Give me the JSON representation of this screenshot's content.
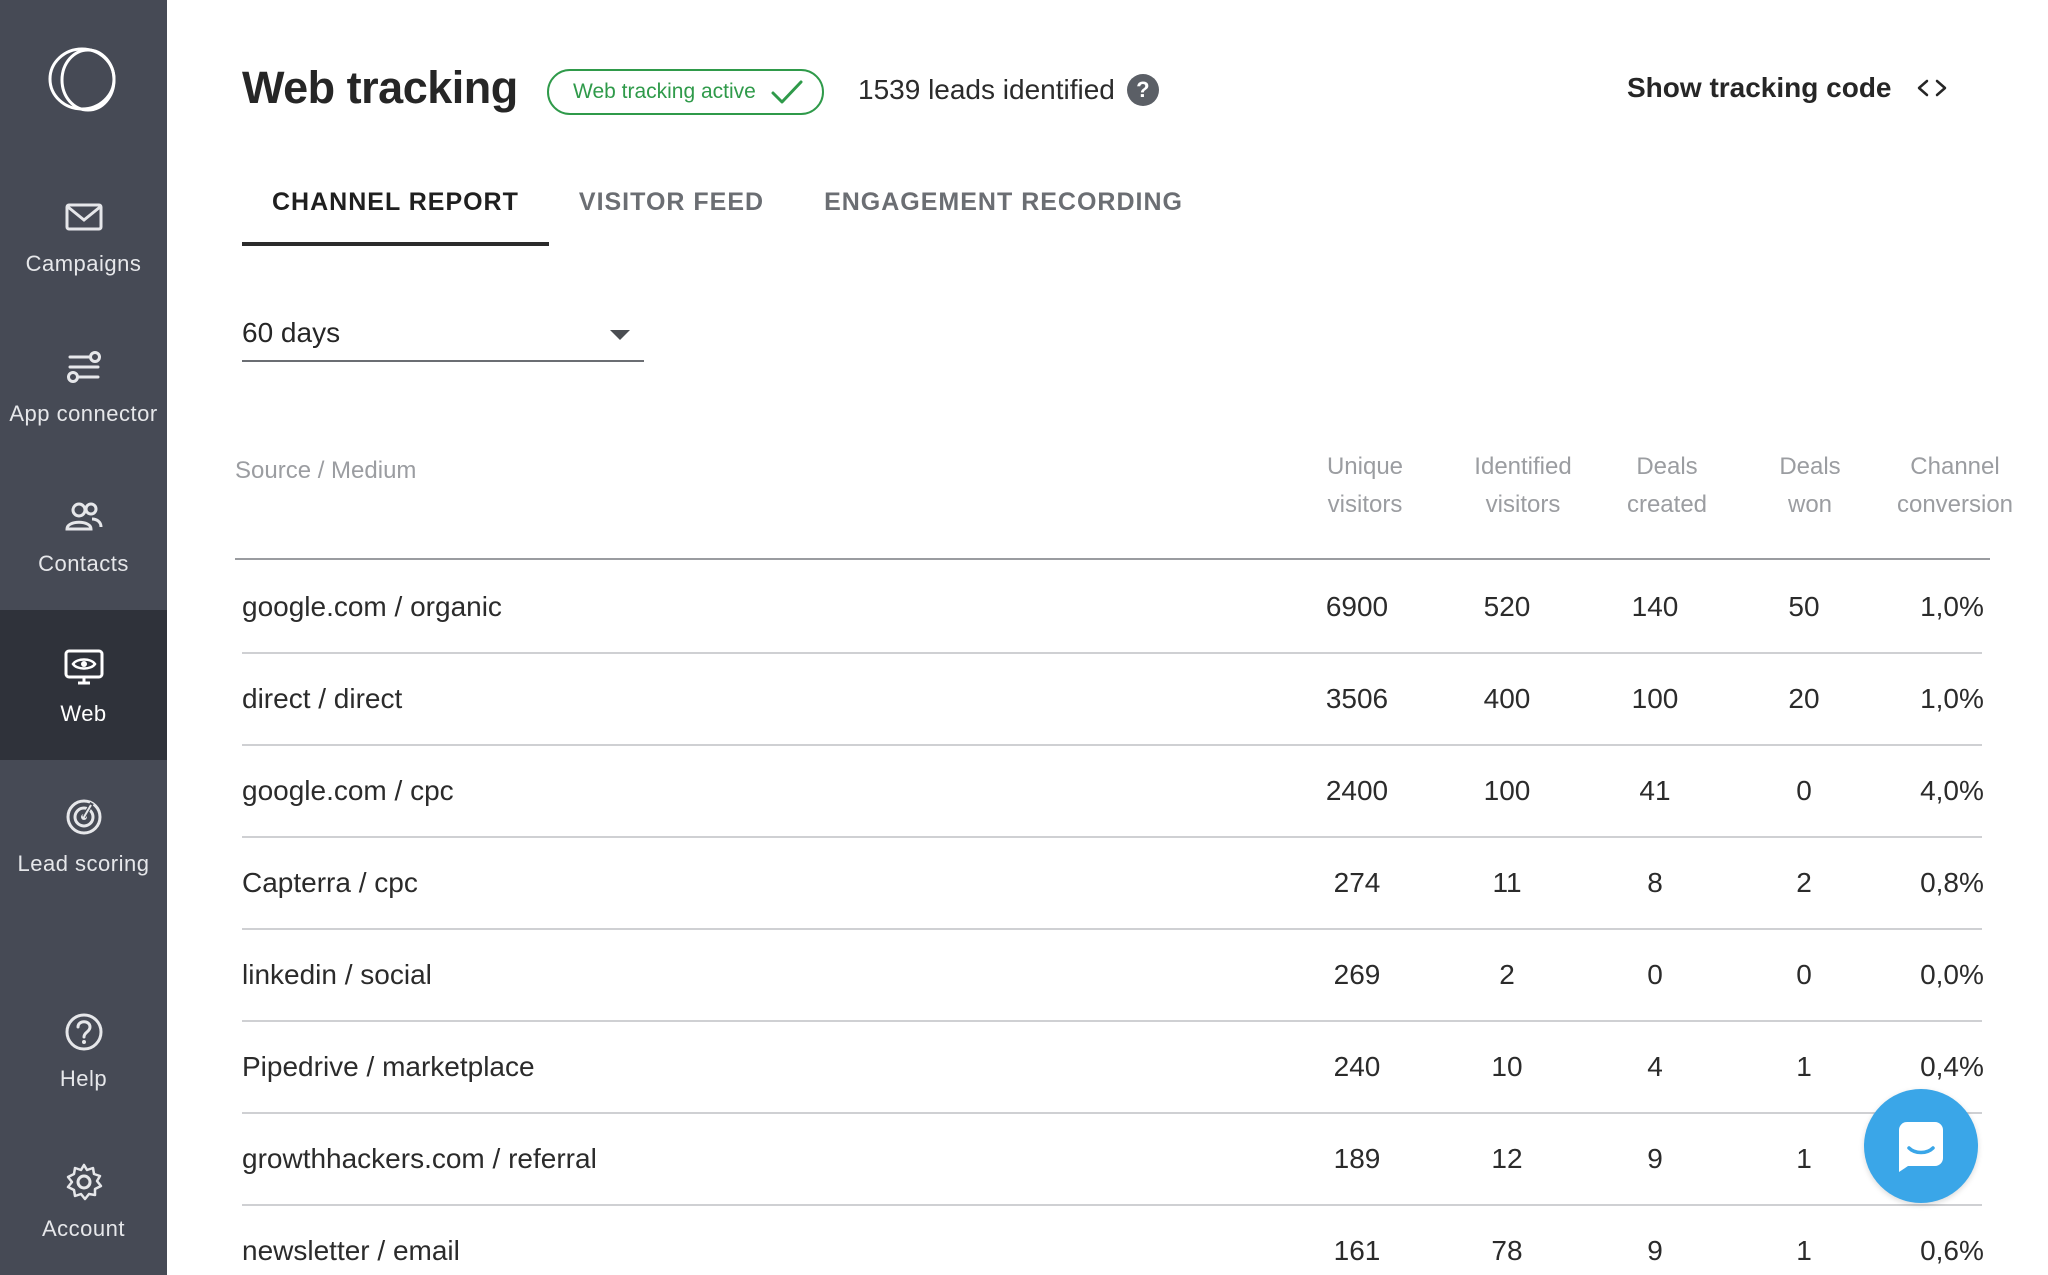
{
  "sidebar": {
    "items": [
      {
        "name": "campaigns",
        "label": "Campaigns",
        "icon": "mail-icon"
      },
      {
        "name": "app-connector",
        "label": "App connector",
        "icon": "connector-icon"
      },
      {
        "name": "contacts",
        "label": "Contacts",
        "icon": "contacts-icon"
      },
      {
        "name": "web",
        "label": "Web",
        "icon": "monitor-eye-icon",
        "active": true
      },
      {
        "name": "lead-scoring",
        "label": "Lead scoring",
        "icon": "target-icon"
      },
      {
        "name": "help",
        "label": "Help",
        "icon": "question-circle-icon"
      },
      {
        "name": "account",
        "label": "Account",
        "icon": "gear-icon"
      }
    ]
  },
  "header": {
    "title": "Web tracking",
    "status_badge": "Web tracking active",
    "leads_identified": "1539 leads identified",
    "help_glyph": "?",
    "tracking_code_link": "Show tracking code"
  },
  "tabs": [
    {
      "label": "CHANNEL REPORT",
      "active": true
    },
    {
      "label": "VISITOR FEED",
      "active": false
    },
    {
      "label": "ENGAGEMENT RECORDING",
      "active": false
    }
  ],
  "range_select": {
    "value": "60 days"
  },
  "table": {
    "headers": {
      "source": "Source  /  Medium",
      "unique_1": "Unique",
      "unique_2": "visitors",
      "identified_1": "Identified",
      "identified_2": "visitors",
      "deals_created_1": "Deals",
      "deals_created_2": "created",
      "deals_won_1": "Deals",
      "deals_won_2": "won",
      "conversion_1": "Channel",
      "conversion_2": "conversion"
    },
    "rows": [
      {
        "source": "google.com  /  organic",
        "unique": "6900",
        "identified": "520",
        "created": "140",
        "won": "50",
        "conversion": "1,0%"
      },
      {
        "source": "direct  /  direct",
        "unique": "3506",
        "identified": "400",
        "created": "100",
        "won": "20",
        "conversion": "1,0%"
      },
      {
        "source": "google.com  /  cpc",
        "unique": "2400",
        "identified": "100",
        "created": "41",
        "won": "0",
        "conversion": "4,0%"
      },
      {
        "source": "Capterra  /  cpc",
        "unique": "274",
        "identified": "11",
        "created": "8",
        "won": "2",
        "conversion": "0,8%"
      },
      {
        "source": "linkedin  /  social",
        "unique": "269",
        "identified": "2",
        "created": "0",
        "won": "0",
        "conversion": "0,0%"
      },
      {
        "source": "Pipedrive  /  marketplace",
        "unique": "240",
        "identified": "10",
        "created": "4",
        "won": "1",
        "conversion": "0,4%"
      },
      {
        "source": "growthhackers.com  /  referral",
        "unique": "189",
        "identified": "12",
        "created": "9",
        "won": "1",
        "conversion": ""
      },
      {
        "source": "newsletter  /  email",
        "unique": "161",
        "identified": "78",
        "created": "9",
        "won": "1",
        "conversion": "0,6%"
      }
    ]
  },
  "colors": {
    "sidebar_bg": "#464a55",
    "sidebar_active_bg": "#2f323a",
    "status_green": "#2f9a4a",
    "chat_blue": "#3aa6e8"
  }
}
